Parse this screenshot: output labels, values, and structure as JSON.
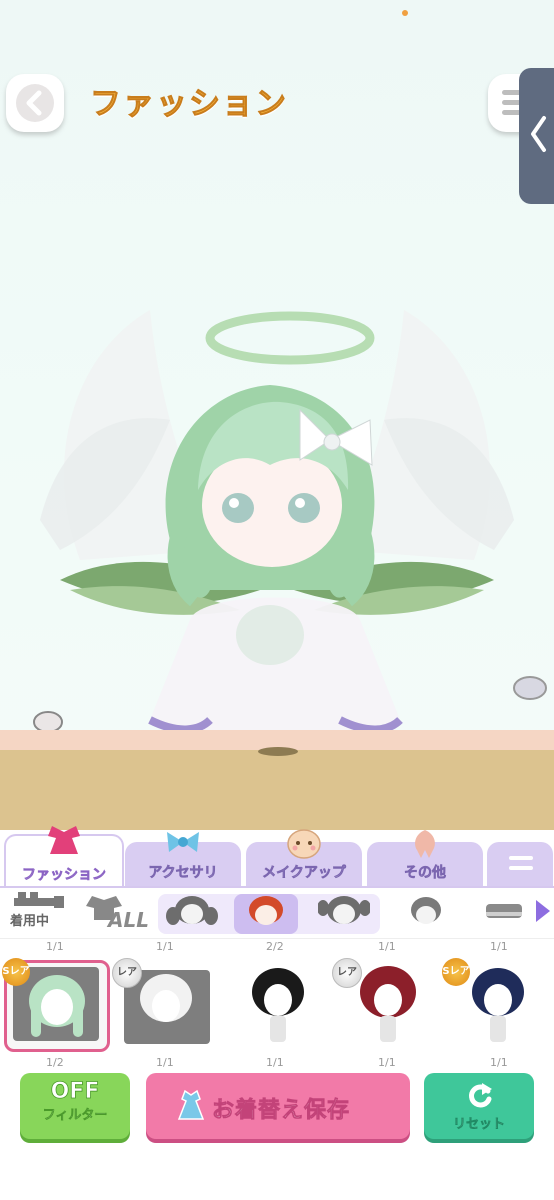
{
  "header": {
    "title": "ファッション"
  },
  "tabs": [
    {
      "label": "ファッション",
      "active": true
    },
    {
      "label": "アクセサリ",
      "active": false
    },
    {
      "label": "メイクアップ",
      "active": false
    },
    {
      "label": "その他",
      "active": false
    }
  ],
  "subcategories": {
    "wearing_label": "着用中",
    "all_label": "ALL",
    "active_index": 1
  },
  "items": [
    {
      "count_top": "1/1",
      "count_bottom": "1/2",
      "rarity": "Sレア",
      "hair_color": "#b9e3c5",
      "selected": true
    },
    {
      "count_top": "1/1",
      "count_bottom": "1/1",
      "rarity": "レア",
      "hair_color": "#f2f2f2",
      "selected": false
    },
    {
      "count_top": "2/2",
      "count_bottom": "1/1",
      "rarity": "",
      "hair_color": "#1a1a1a",
      "selected": false
    },
    {
      "count_top": "1/1",
      "count_bottom": "1/1",
      "rarity": "レア",
      "hair_color": "#8c1f2a",
      "selected": false
    },
    {
      "count_top": "1/1",
      "count_bottom": "1/1",
      "rarity": "Sレア",
      "hair_color": "#1f2c5a",
      "selected": false
    }
  ],
  "buttons": {
    "filter_state": "OFF",
    "filter_label": "フィルター",
    "save_label": "お着替え保存",
    "reset_label": "リセット"
  },
  "colors": {
    "title": "#f6b63e",
    "tab_inactive": "#d9cdf2",
    "filter": "#88d65a",
    "save": "#f27aa8",
    "reset": "#3fc79a",
    "side_tab": "#5f6b80"
  }
}
